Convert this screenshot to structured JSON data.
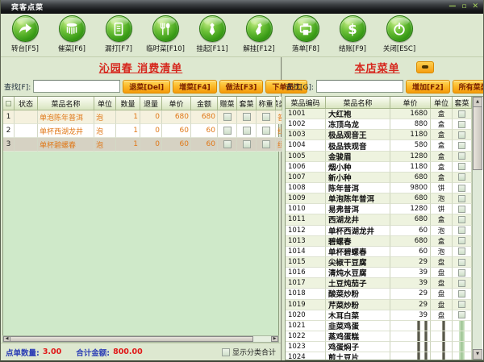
{
  "colors": {
    "toolbar_button_green": "#379a15",
    "accent_button_orange": "#fbb829",
    "panel_title_red": "#d6281e",
    "order_row_text_orange": "#e07818",
    "selected_row_gray": "#d6d2c3",
    "total_label_blue": "#2b3db5",
    "total_value_red": "#e01818",
    "background_sage": "#dde8d0"
  },
  "window": {
    "title": "宾客点菜",
    "controls": [
      {
        "id": "minimize",
        "glyph": "—"
      },
      {
        "id": "maximize",
        "glyph": "▫"
      },
      {
        "id": "close",
        "glyph": "✕"
      }
    ]
  },
  "toolbar": {
    "buttons": [
      {
        "id": "transfer-table",
        "label": "转台[F5]",
        "icon": "arrow"
      },
      {
        "id": "urge-dish",
        "label": "催菜[F6]",
        "icon": "drum"
      },
      {
        "id": "reprint",
        "label": "漏打[F7]",
        "icon": "notepad"
      },
      {
        "id": "temp-dish",
        "label": "临时菜[F10]",
        "icon": "cutlery"
      },
      {
        "id": "hold-order",
        "label": "挂起[F11]",
        "icon": "tie"
      },
      {
        "id": "resume-order",
        "label": "解挂[F12]",
        "icon": "tie2"
      },
      {
        "id": "place-order",
        "label": "落单[F8]",
        "icon": "printer"
      },
      {
        "id": "checkout",
        "label": "结账[F9]",
        "icon": "dollar"
      },
      {
        "id": "close-window",
        "label": "关闭[ESC]",
        "icon": "power"
      }
    ]
  },
  "left_panel": {
    "title": "沁园春  消费清单",
    "search_label": "查找[F]:",
    "search_value": "",
    "buttons": {
      "return_dish": "退菜[Del]",
      "add_dish": "增菜[F4]",
      "cook_method": "做法[F3]",
      "order_staff": "下单员工"
    },
    "table": {
      "headers": [
        "",
        "状态",
        "菜品名称",
        "单位",
        "数量",
        "退量",
        "单价",
        "金额",
        "赠菜",
        "套菜",
        "称重",
        "菜类"
      ],
      "rows": [
        {
          "num": "1",
          "status": "",
          "name": "单泡陈年普洱",
          "unit": "泡",
          "qty": "1",
          "refund": "0",
          "price": "680",
          "amount": "680",
          "category": "普洱",
          "selected": false
        },
        {
          "num": "2",
          "status": "",
          "name": "单杯西湖龙井",
          "unit": "泡",
          "qty": "1",
          "refund": "0",
          "price": "60",
          "amount": "60",
          "category": "绿茶",
          "selected": false
        },
        {
          "num": "3",
          "status": "",
          "name": "单杯碧螺春",
          "unit": "泡",
          "qty": "1",
          "refund": "0",
          "price": "60",
          "amount": "60",
          "category": "绿茶",
          "selected": true
        }
      ]
    },
    "totals": {
      "count_label": "点单数量:",
      "count_value": "3.00",
      "amount_label": "合计金额:",
      "amount_value": "800.00",
      "show_category_label": "显示分类合计"
    }
  },
  "right_panel": {
    "title": "本店菜单",
    "search_label": "查找[G]:",
    "search_value": "",
    "buttons": {
      "add": "增加[F2]",
      "all_categories": "所有菜类 ↓"
    },
    "table": {
      "headers": [
        "菜品编码",
        "菜品名称",
        "单价",
        "单位",
        "套菜"
      ],
      "rows": [
        {
          "code": "1001",
          "name": "大红袍",
          "price": "1680",
          "unit": "盒",
          "smeared": false
        },
        {
          "code": "1002",
          "name": "冻顶乌龙",
          "price": "880",
          "unit": "盒",
          "smeared": false
        },
        {
          "code": "1003",
          "name": "极品观音王",
          "price": "1180",
          "unit": "盒",
          "smeared": false
        },
        {
          "code": "1004",
          "name": "极品铁观音",
          "price": "580",
          "unit": "盒",
          "smeared": false
        },
        {
          "code": "1005",
          "name": "金骏眉",
          "price": "1280",
          "unit": "盒",
          "smeared": false
        },
        {
          "code": "1006",
          "name": "烟小种",
          "price": "1180",
          "unit": "盒",
          "smeared": false
        },
        {
          "code": "1007",
          "name": "新小种",
          "price": "680",
          "unit": "盒",
          "smeared": false
        },
        {
          "code": "1008",
          "name": "陈年普洱",
          "price": "9800",
          "unit": "饼",
          "smeared": false
        },
        {
          "code": "1009",
          "name": "单泡陈年普洱",
          "price": "680",
          "unit": "泡",
          "smeared": false
        },
        {
          "code": "1010",
          "name": "易弗普洱",
          "price": "1280",
          "unit": "饼",
          "smeared": false
        },
        {
          "code": "1011",
          "name": "西湖龙井",
          "price": "680",
          "unit": "盒",
          "smeared": false
        },
        {
          "code": "1012",
          "name": "单杯西湖龙井",
          "price": "60",
          "unit": "泡",
          "smeared": false
        },
        {
          "code": "1013",
          "name": "碧螺春",
          "price": "680",
          "unit": "盒",
          "smeared": false
        },
        {
          "code": "1014",
          "name": "单杯碧螺春",
          "price": "60",
          "unit": "泡",
          "smeared": false
        },
        {
          "code": "1015",
          "name": "尖椒干豆腐",
          "price": "29",
          "unit": "盘",
          "smeared": false
        },
        {
          "code": "1016",
          "name": "清炖水豆腐",
          "price": "39",
          "unit": "盘",
          "smeared": false
        },
        {
          "code": "1017",
          "name": "土豆炖茄子",
          "price": "39",
          "unit": "盘",
          "smeared": false
        },
        {
          "code": "1018",
          "name": "酸菜炒粉",
          "price": "29",
          "unit": "盘",
          "smeared": false
        },
        {
          "code": "1019",
          "name": "芹菜炒粉",
          "price": "29",
          "unit": "盘",
          "smeared": false
        },
        {
          "code": "1020",
          "name": "木耳白菜",
          "price": "39",
          "unit": "盘",
          "smeared": false
        },
        {
          "code": "1021",
          "name": "韭菜鸡蛋",
          "price": "",
          "unit": "",
          "smeared": true
        },
        {
          "code": "1022",
          "name": "蒸鸡蛋糕",
          "price": "",
          "unit": "",
          "smeared": true
        },
        {
          "code": "1023",
          "name": "鸡蛋焖子",
          "price": "",
          "unit": "",
          "smeared": true
        },
        {
          "code": "1024",
          "name": "煎土豆片",
          "price": "",
          "unit": "",
          "smeared": true
        }
      ]
    }
  }
}
